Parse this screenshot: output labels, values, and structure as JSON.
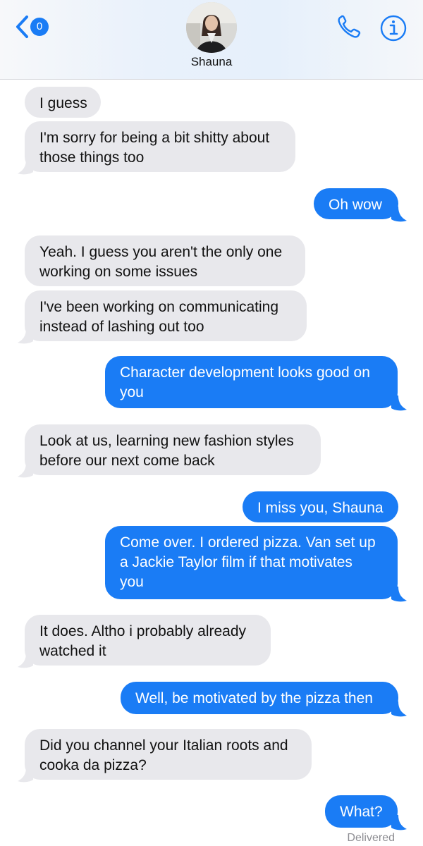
{
  "header": {
    "unread_count": "0",
    "contact_name": "Shauna"
  },
  "colors": {
    "accent": "#1a7cf5",
    "incoming_bubble": "#e8e8ec",
    "status_text": "#8e8e93"
  },
  "icons": [
    "chevron-left-icon",
    "phone-icon",
    "info-icon"
  ],
  "messages": [
    {
      "direction": "incoming",
      "lines": [
        "I guess"
      ]
    },
    {
      "direction": "incoming",
      "lines": [
        "I'm sorry for being a bit shitty about",
        "those things too"
      ]
    },
    {
      "direction": "outgoing",
      "lines": [
        "Oh wow"
      ]
    },
    {
      "direction": "incoming",
      "lines": [
        "Yeah. I guess you aren't the only one",
        "working on some issues"
      ]
    },
    {
      "direction": "incoming",
      "lines": [
        "I've been working on communicating",
        "instead of lashing out too"
      ]
    },
    {
      "direction": "outgoing",
      "lines": [
        "Character development looks good on",
        "you"
      ]
    },
    {
      "direction": "incoming",
      "lines": [
        "Look at us, learning new fashion styles",
        "before our next come back"
      ]
    },
    {
      "direction": "outgoing",
      "lines": [
        "I miss you, Shauna"
      ]
    },
    {
      "direction": "outgoing",
      "lines": [
        "Come over. I ordered pizza. Van set up",
        "a Jackie Taylor film if that motivates",
        "you"
      ]
    },
    {
      "direction": "incoming",
      "lines": [
        "It does. Altho i probably already",
        "watched it"
      ]
    },
    {
      "direction": "outgoing",
      "lines": [
        "Well, be motivated by the pizza then"
      ]
    },
    {
      "direction": "incoming",
      "lines": [
        "Did you channel your Italian roots and",
        "cooka da pizza?"
      ]
    },
    {
      "direction": "outgoing",
      "lines": [
        "What?"
      ]
    }
  ],
  "status": {
    "delivered_label": "Delivered"
  }
}
